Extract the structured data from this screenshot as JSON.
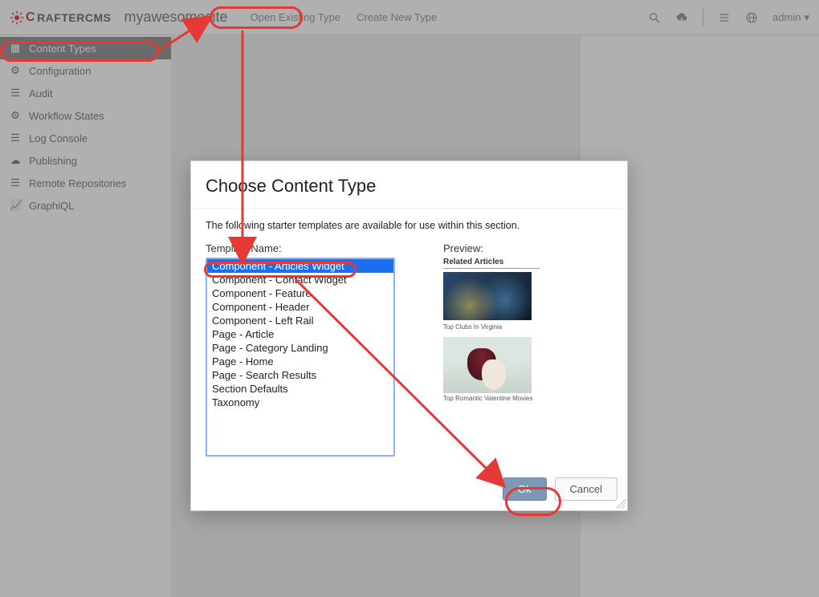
{
  "brand": {
    "c": "C",
    "rest": "RAFTERCMS"
  },
  "sitename": "myawesomesite",
  "topTabs": {
    "openExisting": "Open Existing Type",
    "createNew": "Create New Type"
  },
  "user": {
    "name": "admin"
  },
  "sidebar": {
    "items": [
      {
        "icon": "grid",
        "label": "Content Types"
      },
      {
        "icon": "gear",
        "label": "Configuration"
      },
      {
        "icon": "list",
        "label": "Audit"
      },
      {
        "icon": "gear",
        "label": "Workflow States"
      },
      {
        "icon": "list",
        "label": "Log Console"
      },
      {
        "icon": "cloud",
        "label": "Publishing"
      },
      {
        "icon": "list",
        "label": "Remote Repositories"
      },
      {
        "icon": "chart",
        "label": "GraphiQL"
      }
    ]
  },
  "dialog": {
    "title": "Choose Content Type",
    "desc": "The following starter templates are available for use within this section.",
    "templateNameLabel": "Template Name:",
    "previewLabel": "Preview:",
    "options": [
      "Component - Articles Widget",
      "Component - Contact Widget",
      "Component - Feature",
      "Component - Header",
      "Component - Left Rail",
      "Page - Article",
      "Page - Category Landing",
      "Page - Home",
      "Page - Search Results",
      "Section Defaults",
      "Taxonomy"
    ],
    "selectedIndex": 0,
    "preview": {
      "heading": "Related Articles",
      "cap1": "Top Clubs In Virginia",
      "cap2": "Top Romantic Valentine Movies"
    },
    "ok": "Ok",
    "cancel": "Cancel"
  }
}
